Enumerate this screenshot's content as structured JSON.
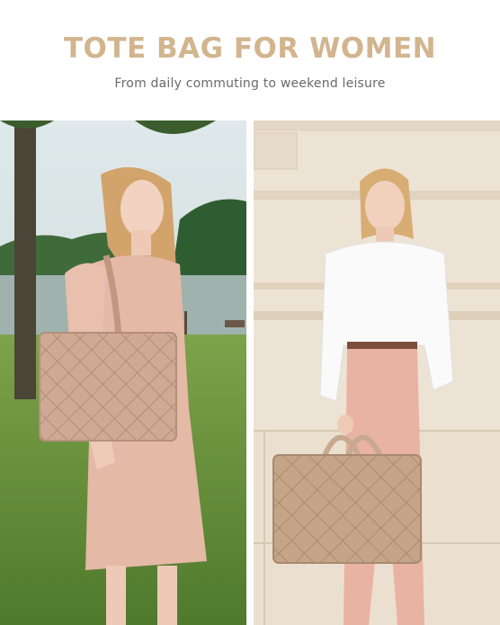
{
  "header": {
    "title": "TOTE BAG FOR WOMEN",
    "subtitle": "From daily commuting to weekend leisure"
  },
  "photos": {
    "left": {
      "scene": "outdoor-lakeside",
      "bag_color": "#c9a48d"
    },
    "right": {
      "scene": "stone-wall",
      "bag_color": "#c2a184"
    }
  },
  "colors": {
    "title": "#d2b48e",
    "subtitle": "#6a6a6a"
  }
}
